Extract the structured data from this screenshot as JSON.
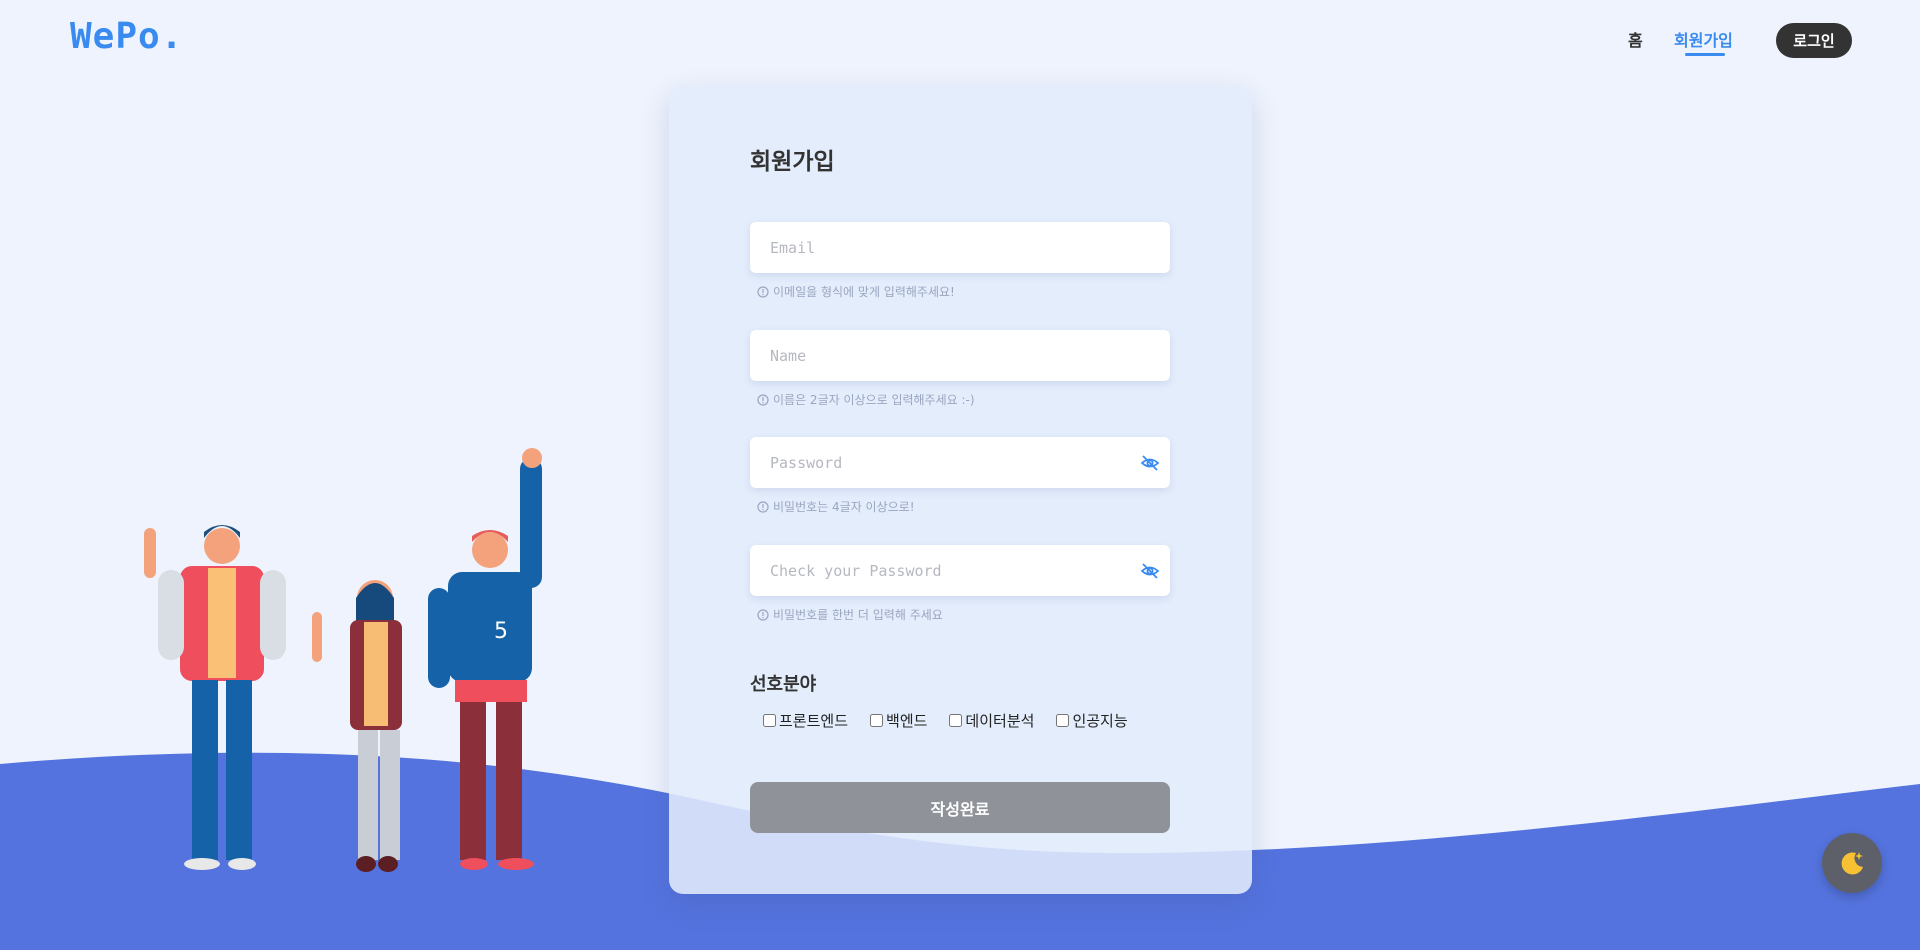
{
  "header": {
    "logo": "WePo.",
    "nav_home": "홈",
    "nav_signup": "회원가입",
    "login_label": "로그인"
  },
  "form": {
    "title": "회원가입",
    "email": {
      "placeholder": "Email",
      "hint": "이메일을 형식에 맞게 입력해주세요!"
    },
    "name": {
      "placeholder": "Name",
      "hint": "이름은 2글자 이상으로 입력해주세요 :-)"
    },
    "password": {
      "placeholder": "Password",
      "hint": "비밀번호는 4글자 이상으로!"
    },
    "password_check": {
      "placeholder": "Check your Password",
      "hint": "비밀번호를 한번 더 입력해 주세요"
    },
    "interests_title": "선호분야",
    "interests": [
      "프론트엔드",
      "백엔드",
      "데이터분석",
      "인공지능"
    ],
    "submit_label": "작성완료"
  },
  "colors": {
    "accent": "#3a8bef",
    "wave": "#5473de",
    "background": "#eef3fd",
    "button_disabled": "#8f9399"
  },
  "icons": {
    "password_toggle": "eye-slash-icon",
    "hint": "info-circle-icon",
    "theme_toggle": "moon-icon"
  }
}
